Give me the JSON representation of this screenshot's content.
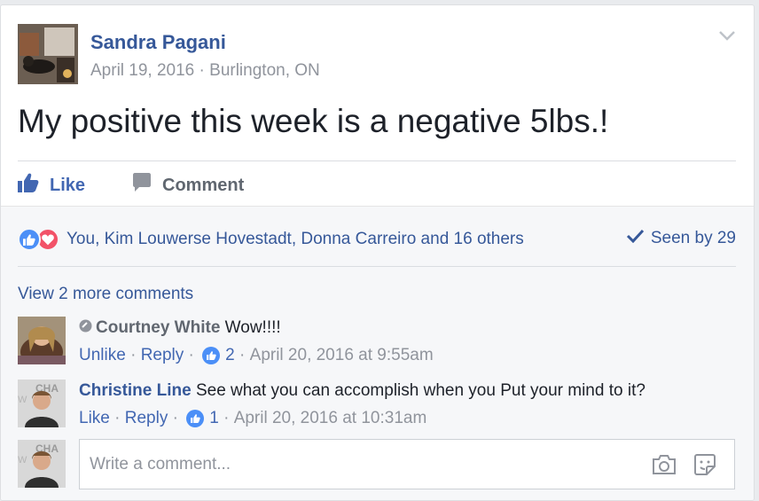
{
  "post": {
    "author": "Sandra Pagani",
    "date": "April 19, 2016",
    "separator": " · ",
    "location": "Burlington, ON",
    "text": "My positive this week is a negative 5lbs.!"
  },
  "actions": {
    "like_label": "Like",
    "comment_label": "Comment"
  },
  "reactions": {
    "names": "You, Kim Louwerse Hovestadt, Donna Carreiro and 16 others",
    "seen": "Seen by 29"
  },
  "comments": {
    "view_more": "View 2 more comments",
    "items": [
      {
        "name": "Courtney White",
        "text": "Wow!!!!",
        "action1": "Unlike",
        "dot": " · ",
        "reply": "Reply",
        "like_count": "2",
        "timestamp": "April 20, 2016 at 9:55am"
      },
      {
        "name": "Christine Line",
        "text": "See what you can accomplish when you Put your mind to it?",
        "action1": "Like",
        "dot": " · ",
        "reply": "Reply",
        "like_count": "1",
        "timestamp": "April 20, 2016 at 10:31am"
      }
    ]
  },
  "composer": {
    "placeholder": "Write a comment..."
  },
  "colors": {
    "link": "#365899",
    "like_blue": "#4b8ff7",
    "love_red": "#f25268",
    "muted": "#90949c"
  }
}
